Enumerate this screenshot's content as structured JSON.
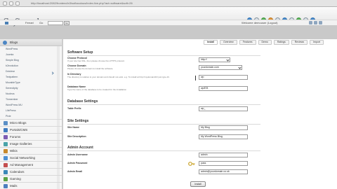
{
  "browser": {
    "url": "http://localhost:2082/frontend/x3/softaculous/index.live.php?act=software&soft=26"
  },
  "header": {
    "logo_text": "Softaculous",
    "user_label": "Ferrari",
    "goto_label": "Go",
    "goto_value": "",
    "go_button": "Go",
    "welcome": "Welcome demouser (Logout)"
  },
  "sidebar": {
    "title": "Blogs",
    "items": [
      {
        "label": "WordPress"
      },
      {
        "label": "Joomla"
      },
      {
        "label": "Simple Blog"
      },
      {
        "label": "b2evolution"
      },
      {
        "label": "Dotclear"
      },
      {
        "label": "Textpattern"
      },
      {
        "label": "MovableType"
      },
      {
        "label": "Serendipity"
      },
      {
        "label": "Nucleus"
      },
      {
        "label": "Tinmember"
      },
      {
        "label": "WordPress MU"
      },
      {
        "label": "LifePress"
      },
      {
        "label": "Pixie"
      }
    ],
    "categories": [
      {
        "label": "Micro Blogs",
        "color": "#5b8fc6"
      },
      {
        "label": "Portals/CMS",
        "color": "#3f7cc0"
      },
      {
        "label": "Forums",
        "color": "#7d5db3"
      },
      {
        "label": "Image Galleries",
        "color": "#4aa3a8"
      },
      {
        "label": "Wikis",
        "color": "#c8892c"
      },
      {
        "label": "Social Networking",
        "color": "#4d90d4"
      },
      {
        "label": "Ad Management",
        "color": "#c44f4f"
      },
      {
        "label": "Calendars",
        "color": "#3b88b8"
      },
      {
        "label": "Gaming",
        "color": "#5ca344"
      },
      {
        "label": "Mails",
        "color": "#4c7ebf"
      }
    ]
  },
  "tabs": [
    "Install",
    "Overview",
    "Features",
    "Demo",
    "Ratings",
    "Reviews",
    "Import"
  ],
  "software_setup": {
    "title": "Software Setup",
    "fields": [
      {
        "label": "Choose Protocol",
        "help": "If your site has SSL, then please choose the HTTPS protocol.",
        "value": "http://"
      },
      {
        "label": "Choose Domain",
        "help": "Please choose the domain to install the software.",
        "value": "yourdomain.com"
      },
      {
        "label": "In Directory",
        "help": "The directory is relative to your domain and should not exist. e.g. To install at http://mydomain/dir/ just type dir.",
        "value": "wp"
      },
      {
        "label": "Database Name",
        "help": "Type the name of the database to be created for the installation",
        "value": "wp878"
      }
    ]
  },
  "database_settings": {
    "title": "Database Settings",
    "fields": [
      {
        "label": "Table Prefix",
        "help": "",
        "value": "wp_"
      }
    ]
  },
  "site_settings": {
    "title": "Site Settings",
    "fields": [
      {
        "label": "Site Name",
        "help": "",
        "value": "My Blog"
      },
      {
        "label": "Site Description",
        "help": "",
        "value": "My WordPress Blog"
      }
    ]
  },
  "admin_account": {
    "title": "Admin Account",
    "fields": [
      {
        "label": "Admin Username",
        "help": "",
        "value": "admin"
      },
      {
        "label": "Admin Password",
        "help": "",
        "value": "pass"
      },
      {
        "label": "Admin Email",
        "help": "",
        "value": "admin@yourdomain.co.uk"
      }
    ]
  },
  "install_button": "Install",
  "icons": [
    "home-icon",
    "key-icon",
    "chevron-down-icon"
  ]
}
